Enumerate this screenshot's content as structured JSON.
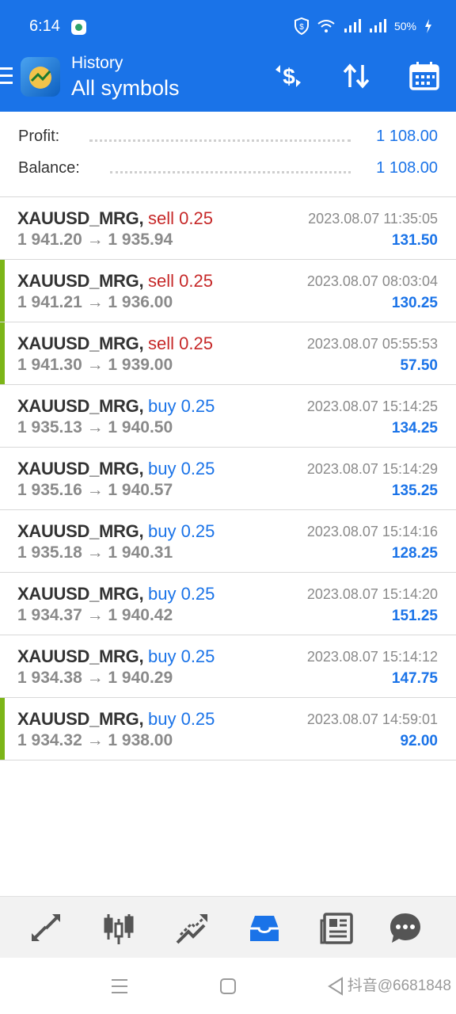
{
  "status_bar": {
    "time": "6:14",
    "battery": "50%"
  },
  "header": {
    "title": "History",
    "subtitle": "All symbols"
  },
  "summary": [
    {
      "label": "Profit:",
      "value": "1 108.00"
    },
    {
      "label": "Balance:",
      "value": "1 108.00"
    }
  ],
  "trades": [
    {
      "symbol": "XAUUSD_MRG,",
      "type": "sell 0.25",
      "side": "sell",
      "prices": "1 941.20 → 1 935.94",
      "time": "2023.08.07 11:35:05",
      "profit": "131.50",
      "marked": false
    },
    {
      "symbol": "XAUUSD_MRG,",
      "type": "sell 0.25",
      "side": "sell",
      "prices": "1 941.21 → 1 936.00",
      "time": "2023.08.07 08:03:04",
      "profit": "130.25",
      "marked": true
    },
    {
      "symbol": "XAUUSD_MRG,",
      "type": "sell 0.25",
      "side": "sell",
      "prices": "1 941.30 → 1 939.00",
      "time": "2023.08.07 05:55:53",
      "profit": "57.50",
      "marked": true
    },
    {
      "symbol": "XAUUSD_MRG,",
      "type": "buy 0.25",
      "side": "buy",
      "prices": "1 935.13 → 1 940.50",
      "time": "2023.08.07 15:14:25",
      "profit": "134.25",
      "marked": false
    },
    {
      "symbol": "XAUUSD_MRG,",
      "type": "buy 0.25",
      "side": "buy",
      "prices": "1 935.16 → 1 940.57",
      "time": "2023.08.07 15:14:29",
      "profit": "135.25",
      "marked": false
    },
    {
      "symbol": "XAUUSD_MRG,",
      "type": "buy 0.25",
      "side": "buy",
      "prices": "1 935.18 → 1 940.31",
      "time": "2023.08.07 15:14:16",
      "profit": "128.25",
      "marked": false
    },
    {
      "symbol": "XAUUSD_MRG,",
      "type": "buy 0.25",
      "side": "buy",
      "prices": "1 934.37 → 1 940.42",
      "time": "2023.08.07 15:14:20",
      "profit": "151.25",
      "marked": false
    },
    {
      "symbol": "XAUUSD_MRG,",
      "type": "buy 0.25",
      "side": "buy",
      "prices": "1 934.38 → 1 940.29",
      "time": "2023.08.07 15:14:12",
      "profit": "147.75",
      "marked": false
    },
    {
      "symbol": "XAUUSD_MRG,",
      "type": "buy 0.25",
      "side": "buy",
      "prices": "1 934.32 → 1 938.00",
      "time": "2023.08.07 14:59:01",
      "profit": "92.00",
      "marked": true
    }
  ],
  "bottom_nav": [
    "quotes-icon",
    "chart-icon",
    "trade-icon",
    "history-icon",
    "news-icon",
    "chat-icon"
  ],
  "watermark": "抖音@6681848",
  "colors": {
    "header_bg": "#1a73e8",
    "sell": "#c62828",
    "buy": "#1a73e8",
    "marker": "#7cb518"
  }
}
